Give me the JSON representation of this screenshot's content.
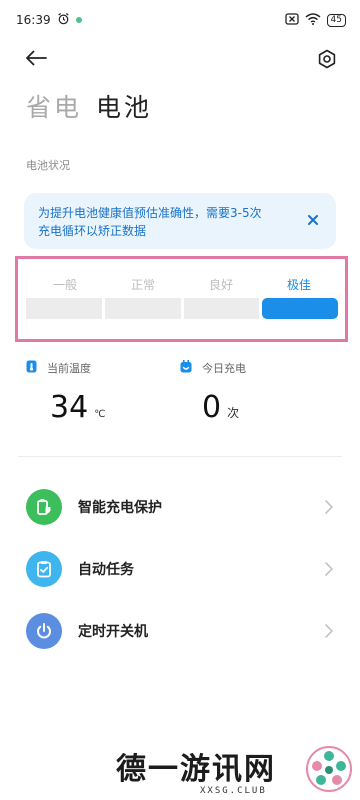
{
  "status_bar": {
    "time": "16:39",
    "battery_level": "45",
    "icons": [
      "alarm-icon",
      "notification-dot-icon",
      "silent-icon",
      "wifi-icon",
      "battery-icon"
    ]
  },
  "header": {
    "back_icon": "arrow-left-icon",
    "settings_icon": "gear-icon",
    "title_muted": "省电",
    "title_main": "电池"
  },
  "battery_status": {
    "section_label": "电池状况",
    "tip": {
      "line1": "为提升电池健康值预估准确性，需要3-5次",
      "line2": "充电循环以矫正数据"
    },
    "grades": [
      {
        "label": "一般",
        "active": false
      },
      {
        "label": "正常",
        "active": false
      },
      {
        "label": "良好",
        "active": false
      },
      {
        "label": "极佳",
        "active": true
      }
    ],
    "current_grade": "极佳"
  },
  "stats": {
    "temperature": {
      "label": "当前温度",
      "value": "34",
      "unit": "℃"
    },
    "charges_today": {
      "label": "今日充电",
      "value": "0",
      "unit": "次"
    }
  },
  "menu": {
    "items": [
      {
        "label": "智能充电保护",
        "icon": "battery-shield-icon",
        "color": "#3cbe5c"
      },
      {
        "label": "自动任务",
        "icon": "clipboard-check-icon",
        "color": "#3fb5ee"
      },
      {
        "label": "定时开关机",
        "icon": "power-icon",
        "color": "#5b8ee0"
      }
    ]
  },
  "watermark": {
    "text": "德一游讯网",
    "sub": "XXSG.CLUB"
  },
  "colors": {
    "accent": "#1a8ee9",
    "tip_bg": "#eaf4fd",
    "highlight_frame": "#e07aa4"
  }
}
